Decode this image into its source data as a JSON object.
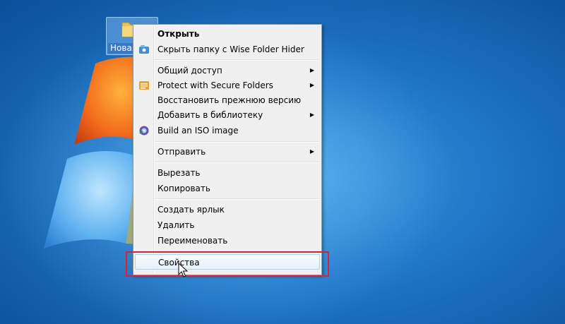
{
  "desktop": {
    "folder_label": "Новая"
  },
  "menu": {
    "items": [
      {
        "label": "Открыть"
      },
      {
        "label": "Скрыть папку с Wise Folder Hider",
        "icon": "wise-folder-hider-icon"
      },
      {
        "label": "Общий доступ",
        "submenu": true
      },
      {
        "label": "Protect with Secure Folders",
        "icon": "secure-folders-icon",
        "submenu": true
      },
      {
        "label": "Восстановить прежнюю версию"
      },
      {
        "label": "Добавить в библиотеку",
        "submenu": true
      },
      {
        "label": "Build an ISO image",
        "icon": "iso-builder-icon"
      },
      {
        "label": "Отправить",
        "submenu": true
      },
      {
        "label": "Вырезать"
      },
      {
        "label": "Копировать"
      },
      {
        "label": "Создать ярлык"
      },
      {
        "label": "Удалить"
      },
      {
        "label": "Переименовать"
      },
      {
        "label": "Свойства"
      }
    ],
    "arrow": "▶"
  },
  "colors": {
    "highlight": "#d9232e",
    "desktop_blue": "#1f78c8"
  }
}
